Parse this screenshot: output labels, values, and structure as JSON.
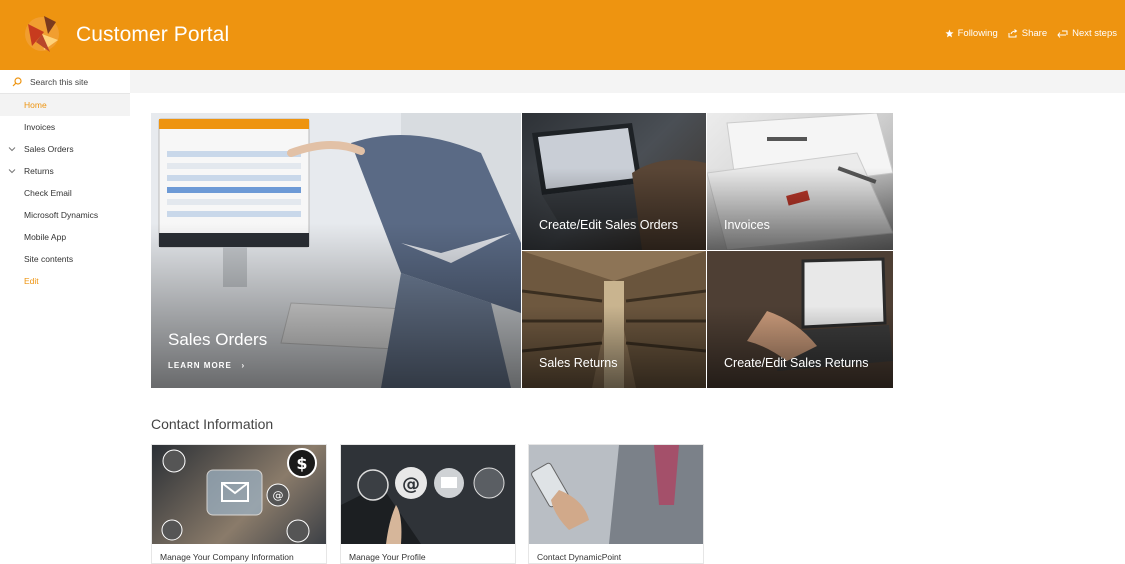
{
  "header": {
    "title": "Customer Portal",
    "actions": [
      {
        "label": "Following",
        "icon": "star-icon"
      },
      {
        "label": "Share",
        "icon": "share-icon"
      },
      {
        "label": "Next steps",
        "icon": "next-steps-icon"
      }
    ],
    "background_color": "#ee9410"
  },
  "search": {
    "placeholder": "Search this site"
  },
  "nav": [
    {
      "label": "Home",
      "active": true
    },
    {
      "label": "Invoices"
    },
    {
      "label": "Sales Orders",
      "expandable": true
    },
    {
      "label": "Returns",
      "expandable": true
    },
    {
      "label": "Check Email"
    },
    {
      "label": "Microsoft Dynamics"
    },
    {
      "label": "Mobile App"
    },
    {
      "label": "Site contents"
    },
    {
      "label": "Edit"
    }
  ],
  "hero": {
    "main": {
      "title": "Sales Orders",
      "link": "LEARN MORE"
    },
    "tiles": [
      {
        "title": "Create/Edit Sales Orders"
      },
      {
        "title": "Invoices"
      },
      {
        "title": "Sales Returns"
      },
      {
        "title": "Create/Edit Sales Returns"
      }
    ]
  },
  "contact": {
    "title": "Contact Information",
    "cards": [
      {
        "label": "Manage Your Company Information"
      },
      {
        "label": "Manage Your Profile"
      },
      {
        "label": "Contact DynamicPoint"
      }
    ]
  }
}
